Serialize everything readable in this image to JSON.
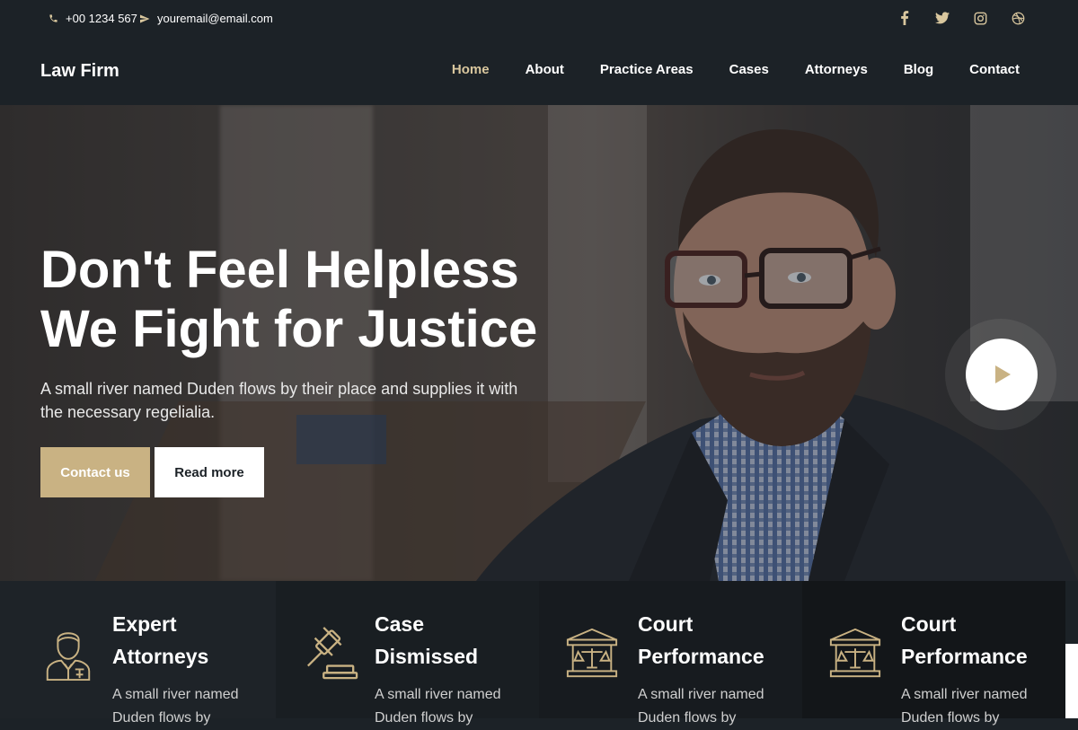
{
  "topbar": {
    "phone": "+00 1234 567",
    "email": "youremail@email.com",
    "social": [
      "facebook-icon",
      "twitter-icon",
      "instagram-icon",
      "dribbble-icon"
    ]
  },
  "navbar": {
    "brand": "Law Firm",
    "items": [
      {
        "label": "Home",
        "active": true
      },
      {
        "label": "About"
      },
      {
        "label": "Practice Areas"
      },
      {
        "label": "Cases"
      },
      {
        "label": "Attorneys"
      },
      {
        "label": "Blog"
      },
      {
        "label": "Contact"
      }
    ]
  },
  "hero": {
    "title_line1": "Don't Feel Helpless",
    "title_line2": "We Fight for Justice",
    "text": "A small river named Duden flows by their place and supplies it with the necessary regelialia.",
    "contact_label": "Contact us",
    "read_label": "Read more"
  },
  "features": [
    {
      "icon": "attorney-icon",
      "title": "Expert Attorneys",
      "text": "A small river named Duden flows by"
    },
    {
      "icon": "gavel-icon",
      "title": "Case Dismissed",
      "text": "A small river named Duden flows by"
    },
    {
      "icon": "courthouse-icon",
      "title": "Court Performance",
      "text": "A small river named Duden flows by"
    },
    {
      "icon": "courthouse-icon",
      "title": "Court Performance",
      "text": "A small river named Duden flows by"
    }
  ],
  "colors": {
    "accent": "#c9b283",
    "dark": "#1c2227"
  }
}
